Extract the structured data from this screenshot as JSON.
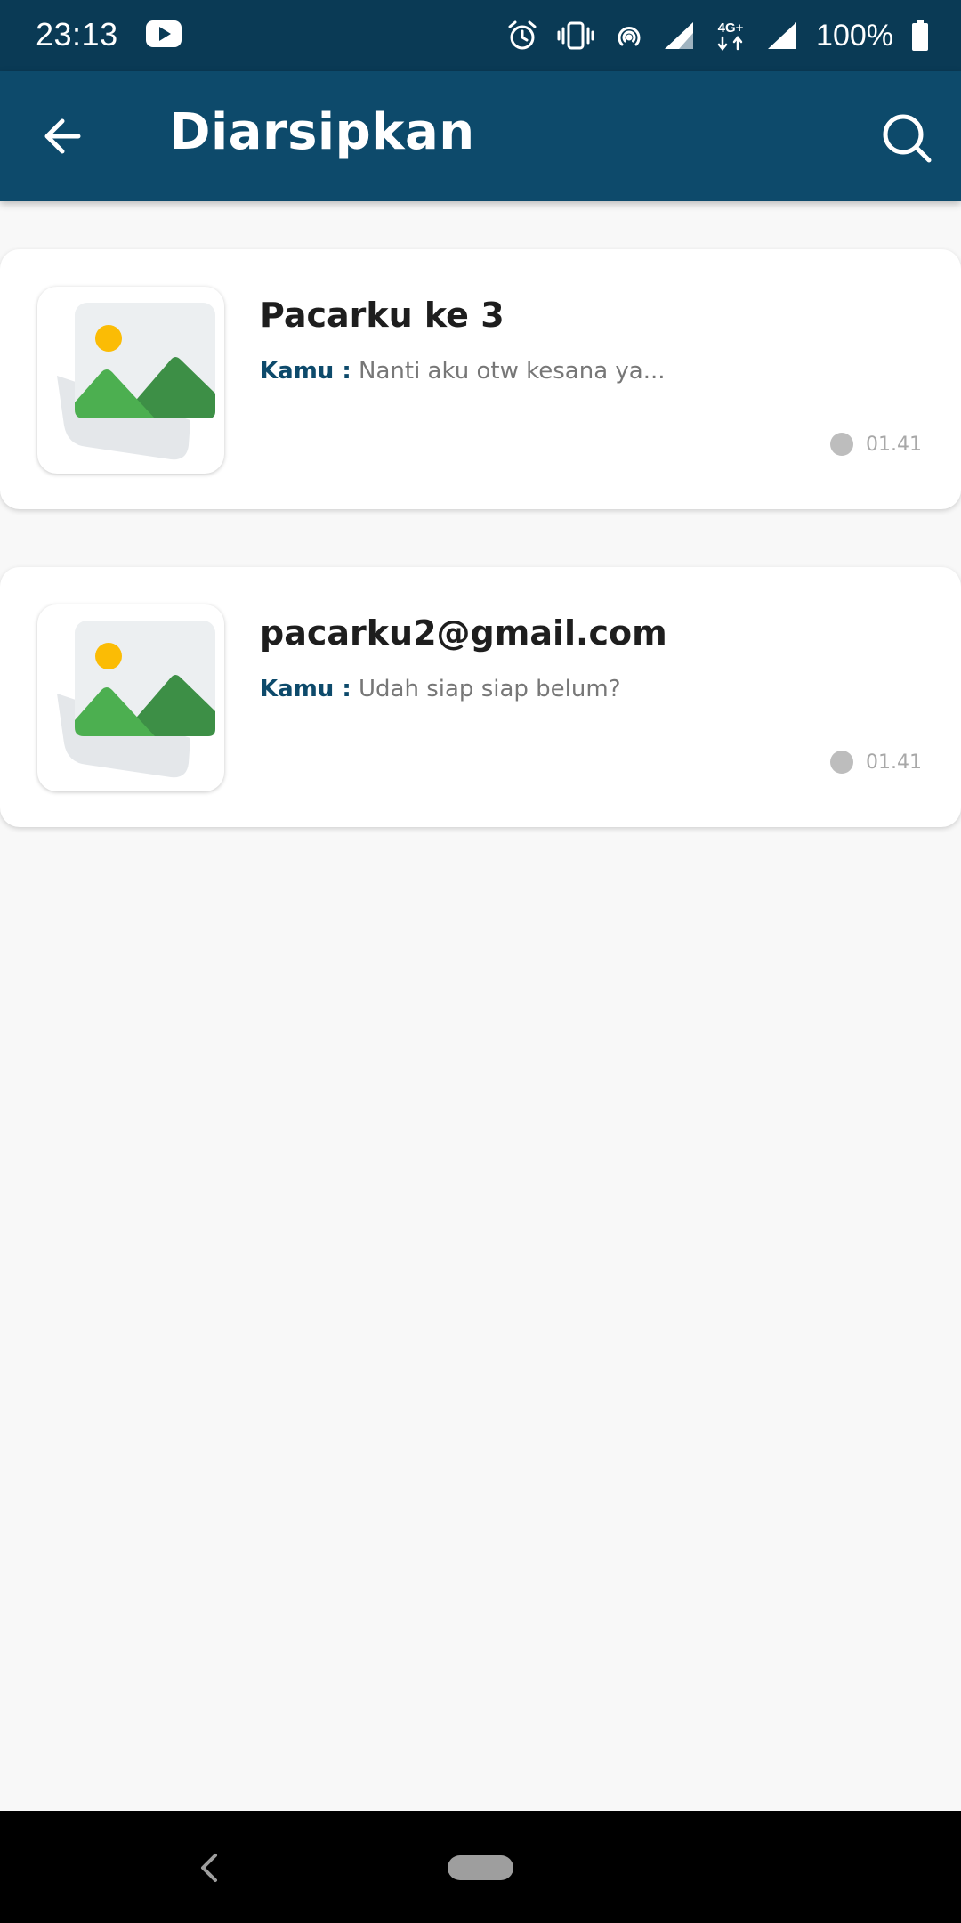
{
  "status_bar": {
    "time": "23:13",
    "app_icon": "youtube-icon",
    "icons": [
      "alarm-icon",
      "vibrate-icon",
      "hotspot-icon",
      "signal-icon",
      "network-4g-icon",
      "signal-icon"
    ],
    "network_label": "4G+",
    "battery_percent": "100%"
  },
  "app_bar": {
    "back_icon": "arrow-left-icon",
    "title": "Diarsipkan",
    "search_icon": "search-icon",
    "background_color": "#0d4a6b"
  },
  "chats": [
    {
      "name": "Pacarku ke 3",
      "sender_label": "Kamu :",
      "preview": "Nanti aku otw kesana ya...",
      "time": "01.41",
      "avatar_icon": "image-placeholder-icon"
    },
    {
      "name": "pacarku2@gmail.com",
      "sender_label": "Kamu :",
      "preview": "Udah siap siap belum?",
      "time": "01.41",
      "avatar_icon": "image-placeholder-icon"
    }
  ],
  "nav_bar": {
    "back_icon": "nav-back-icon",
    "home_icon": "nav-home-pill"
  }
}
